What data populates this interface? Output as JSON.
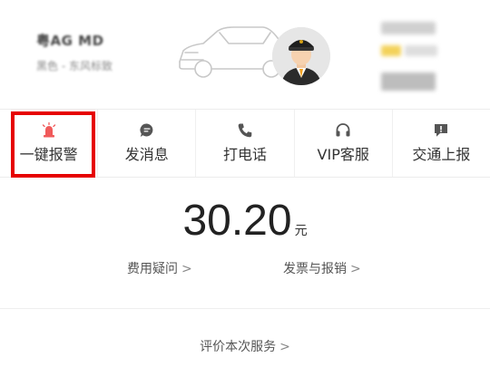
{
  "driver": {
    "plate_text": "粤AG MD",
    "car_info_text": "黑色 - 东风标致"
  },
  "actions": [
    {
      "label": "一键报警",
      "icon": "alarm-icon",
      "color": "#f05a5a"
    },
    {
      "label": "发消息",
      "icon": "message-icon",
      "color": "#555555"
    },
    {
      "label": "打电话",
      "icon": "phone-icon",
      "color": "#555555"
    },
    {
      "label": "VIP客服",
      "icon": "headset-icon",
      "color": "#555555"
    },
    {
      "label": "交通上报",
      "icon": "report-icon",
      "color": "#555555"
    }
  ],
  "fare": {
    "amount": "30.20",
    "unit": "元"
  },
  "links": {
    "fee_question": "费用疑问",
    "invoice": "发票与报销",
    "rate_service": "评价本次服务"
  },
  "colors": {
    "highlight": "#e60000",
    "text": "#333333",
    "accent_alarm": "#f05a5a"
  }
}
